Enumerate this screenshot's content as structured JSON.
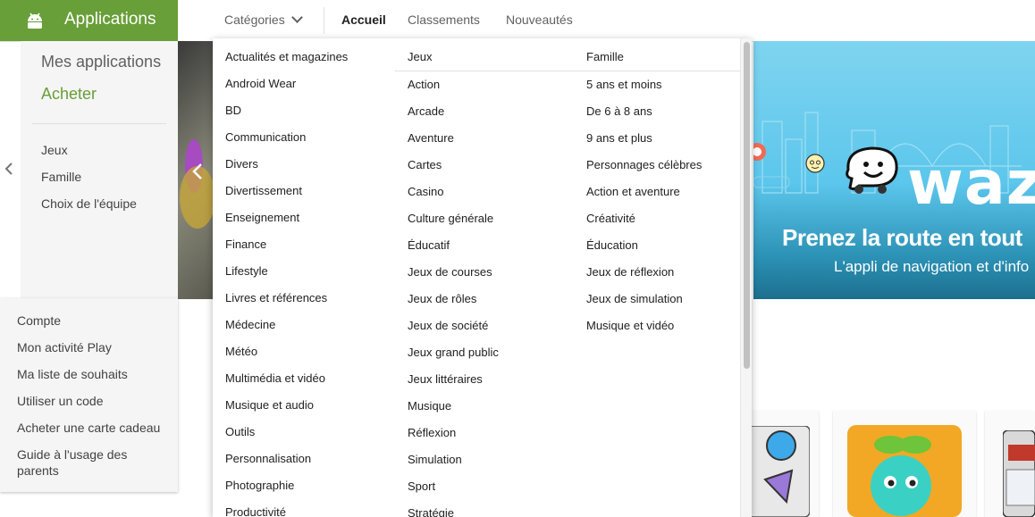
{
  "header": {
    "app_title": "Applications",
    "categories_label": "Catégories",
    "tabs": [
      "Accueil",
      "Classements",
      "Nouveautés"
    ]
  },
  "sidebar": {
    "my_apps": "Mes applications",
    "shop": "Acheter",
    "items": [
      "Jeux",
      "Famille",
      "Choix de l'équipe"
    ]
  },
  "account_menu": {
    "items": [
      "Compte",
      "Mon activité Play",
      "Ma liste de souhaits",
      "Utiliser un code",
      "Acheter une carte cadeau",
      "Guide à l'usage des parents"
    ]
  },
  "hero": {
    "logo_text": "waze",
    "headline": "Prenez la route en tout",
    "subline": "L'appli de navigation et d'info"
  },
  "dropdown": {
    "col1": [
      "Actualités et magazines",
      "Android Wear",
      "BD",
      "Communication",
      "Divers",
      "Divertissement",
      "Enseignement",
      "Finance",
      "Lifestyle",
      "Livres et références",
      "Médecine",
      "Météo",
      "Multimédia et vidéo",
      "Musique et audio",
      "Outils",
      "Personnalisation",
      "Photographie",
      "Productivité"
    ],
    "col2_header": "Jeux",
    "col2": [
      "Action",
      "Arcade",
      "Aventure",
      "Cartes",
      "Casino",
      "Culture générale",
      "Éducatif",
      "Jeux de courses",
      "Jeux de rôles",
      "Jeux de société",
      "Jeux grand public",
      "Jeux littéraires",
      "Musique",
      "Réflexion",
      "Simulation",
      "Sport",
      "Stratégie"
    ],
    "col3_header": "Famille",
    "col3": [
      "5 ans et moins",
      "De 6 à 8 ans",
      "9 ans et plus",
      "Personnages célèbres",
      "Action et aventure",
      "Créativité",
      "Éducation",
      "Jeux de réflexion",
      "Jeux de simulation",
      "Musique et vidéo"
    ]
  },
  "colors": {
    "brand_green": "#689f38",
    "sidebar_bg": "#f5f5f5"
  }
}
